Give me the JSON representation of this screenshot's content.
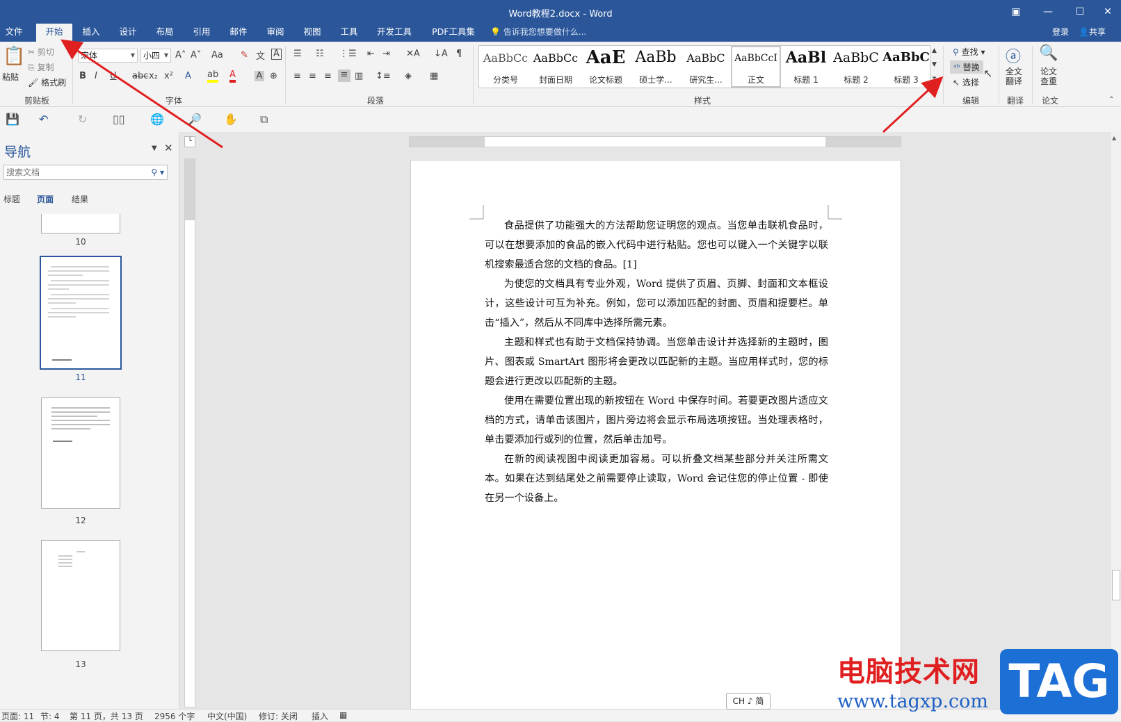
{
  "window": {
    "title": "Word教程2.docx - Word",
    "controls": [
      "▣",
      "—",
      "☐",
      "✕"
    ]
  },
  "tabs": [
    {
      "label": "文件"
    },
    {
      "label": "开始",
      "active": true
    },
    {
      "label": "插入"
    },
    {
      "label": "设计"
    },
    {
      "label": "布局"
    },
    {
      "label": "引用"
    },
    {
      "label": "邮件"
    },
    {
      "label": "审阅"
    },
    {
      "label": "视图"
    },
    {
      "label": "工具"
    },
    {
      "label": "开发工具"
    },
    {
      "label": "PDF工具集"
    }
  ],
  "tell_me": "告诉我您想要做什么...",
  "account": {
    "login": "登录",
    "share": "共享"
  },
  "clipboard": {
    "paste": "粘贴",
    "cut": "剪切",
    "copy": "复制",
    "format_painter": "格式刷",
    "label": "剪贴板"
  },
  "font": {
    "name": "宋体",
    "size": "小四",
    "label": "字体",
    "case_btn": "Aa"
  },
  "paragraph": {
    "label": "段落"
  },
  "styles": {
    "label": "样式",
    "items": [
      {
        "preview": "AaBbCc",
        "name": "分类号"
      },
      {
        "preview": "AaBbCc",
        "name": "封面日期"
      },
      {
        "preview": "AaE",
        "name": "论文标题"
      },
      {
        "preview": "AaBb",
        "name": "硕士学..."
      },
      {
        "preview": "AaBbC",
        "name": "研究生..."
      },
      {
        "preview": "AaBbCcI",
        "name": "正文"
      },
      {
        "preview": "AaBl",
        "name": "标题 1"
      },
      {
        "preview": "AaBbC",
        "name": "标题 2"
      },
      {
        "preview": "AaBbC",
        "name": "标题 3"
      }
    ]
  },
  "editing": {
    "find": "查找",
    "replace": "替换",
    "select": "选择",
    "label": "编辑"
  },
  "translate": {
    "full": "全文\n翻译",
    "label": "翻译"
  },
  "paper": {
    "check": "论文\n查重",
    "label": "论文"
  },
  "nav": {
    "title": "导航",
    "search_placeholder": "搜索文档",
    "tabs": [
      "标题",
      "页面",
      "结果"
    ],
    "pages": [
      "10",
      "11",
      "12",
      "13"
    ]
  },
  "document": {
    "paragraphs": [
      "食品提供了功能强大的方法帮助您证明您的观点。当您单击联机食品时，可以在想要添加的食品的嵌入代码中进行粘贴。您也可以键入一个关键字以联机搜索最适合您的文档的食品。[1]",
      "为使您的文档具有专业外观，Word 提供了页眉、页脚、封面和文本框设计，这些设计可互为补充。例如，您可以添加匹配的封面、页眉和提要栏。单击“插入”，然后从不同库中选择所需元素。",
      "主题和样式也有助于文档保持协调。当您单击设计并选择新的主题时，图片、图表或 SmartArt 图形将会更改以匹配新的主题。当应用样式时，您的标题会进行更改以匹配新的主题。",
      "使用在需要位置出现的新按钮在 Word 中保存时间。若要更改图片适应文档的方式，请单击该图片，图片旁边将会显示布局选项按钮。当处理表格时，单击要添加行或列的位置，然后单击加号。",
      "在新的阅读视图中阅读更加容易。可以折叠文档某些部分并关注所需文本。如果在达到结尾处之前需要停止读取，Word 会记住您的停止位置 - 即使在另一个设备上。"
    ]
  },
  "status": {
    "page": "页面: 11",
    "section": "节: 4",
    "page_of": "第 11 页，共 13 页",
    "words": "2956 个字",
    "lang": "中文(中国)",
    "track": "修订: 关闭",
    "mode": "插入"
  },
  "ime": "CH ♪ 简",
  "watermark": {
    "cn": "电脑技术网",
    "url": "www.tagxp.com",
    "tag": "TAG"
  },
  "colors": {
    "accent": "#2b579a",
    "arrow": "#e02020"
  }
}
